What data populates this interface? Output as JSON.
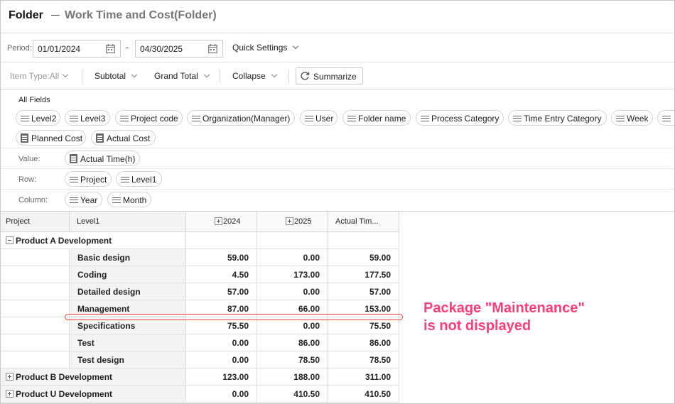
{
  "window": {
    "title": "Folder",
    "subtitle": "Work Time and Cost(Folder)"
  },
  "period": {
    "label": "Period:",
    "start": "01/01/2024",
    "separator": "-",
    "end": "04/30/2025",
    "quick_settings": "Quick Settings"
  },
  "toolbar": {
    "item_type": "Item Type:All",
    "subtotal": "Subtotal",
    "grand_total": "Grand Total",
    "collapse": "Collapse",
    "summarize": "Summarize"
  },
  "fields": {
    "all_fields_label": "All Fields",
    "all_fields": [
      {
        "label": "Level2",
        "icon": "list-icon"
      },
      {
        "label": "Level3",
        "icon": "list-icon"
      },
      {
        "label": "Project code",
        "icon": "list-icon"
      },
      {
        "label": "Organization(Manager)",
        "icon": "list-icon"
      },
      {
        "label": "User",
        "icon": "list-icon"
      },
      {
        "label": "Folder name",
        "icon": "list-icon"
      },
      {
        "label": "Process Category",
        "icon": "list-icon"
      },
      {
        "label": "Time Entry Category",
        "icon": "list-icon"
      },
      {
        "label": "Week",
        "icon": "list-icon"
      },
      {
        "label": "Planned Cost",
        "icon": "measure-icon"
      },
      {
        "label": "Actual Cost",
        "icon": "measure-icon"
      }
    ],
    "value_label": "Value:",
    "value_fields": [
      "Actual Time(h)"
    ],
    "row_label": "Row:",
    "row_fields": [
      "Project",
      "Level1"
    ],
    "column_label": "Column:",
    "column_fields": [
      "Year",
      "Month"
    ]
  },
  "grid": {
    "headers": {
      "project": "Project",
      "level1": "Level1",
      "y2024": "2024",
      "y2025": "2025",
      "total": "Actual Tim..."
    },
    "group_a": "Product A Development",
    "rows": [
      {
        "level1": "Basic design",
        "v2024": "59.00",
        "v2025": "0.00",
        "total": "59.00"
      },
      {
        "level1": "Coding",
        "v2024": "4.50",
        "v2025": "173.00",
        "total": "177.50"
      },
      {
        "level1": "Detailed design",
        "v2024": "57.00",
        "v2025": "0.00",
        "total": "57.00"
      },
      {
        "level1": "Management",
        "v2024": "87.00",
        "v2025": "66.00",
        "total": "153.00"
      },
      {
        "level1": "Specifications",
        "v2024": "75.50",
        "v2025": "0.00",
        "total": "75.50"
      },
      {
        "level1": "Test",
        "v2024": "0.00",
        "v2025": "86.00",
        "total": "86.00"
      },
      {
        "level1": "Test design",
        "v2024": "0.00",
        "v2025": "78.50",
        "total": "78.50"
      }
    ],
    "collapsed_groups": [
      {
        "project": "Product B Development",
        "v2024": "123.00",
        "v2025": "188.00",
        "total": "311.00"
      },
      {
        "project": "Product U Development",
        "v2024": "0.00",
        "v2025": "410.50",
        "total": "410.50"
      }
    ]
  },
  "annotation": {
    "line1": "Package \"Maintenance\"",
    "line2": "is not displayed",
    "color": "#ff3c78"
  }
}
